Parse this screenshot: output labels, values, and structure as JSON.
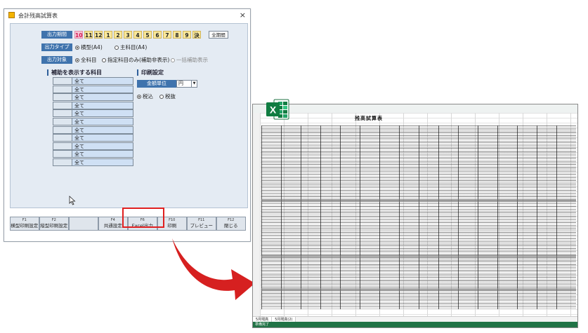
{
  "window": {
    "title": "会計残高試算表",
    "close": "×"
  },
  "output_period": {
    "label": "出力期間",
    "months": [
      "10",
      "11",
      "12",
      "1",
      "2",
      "3",
      "4",
      "5",
      "6",
      "7",
      "8",
      "9",
      "決"
    ],
    "all_button": "全期間"
  },
  "output_type": {
    "label": "出力タイプ",
    "options": [
      {
        "label": "横型(A4)",
        "selected": true
      },
      {
        "label": "主科目(A4)",
        "selected": false
      }
    ]
  },
  "output_target": {
    "label": "出力対象",
    "options": [
      {
        "label": "全科目",
        "selected": true
      },
      {
        "label": "指定科目のみ(補助非表示)",
        "selected": false
      },
      {
        "label": "一括補助表示",
        "selected": false
      }
    ]
  },
  "subaccounts": {
    "heading": "補助を表示する科目",
    "rows": [
      "全て",
      "全て",
      "全て",
      "全て",
      "全て",
      "全て",
      "全て",
      "全て",
      "全て",
      "全て",
      "全て"
    ]
  },
  "print_settings": {
    "heading": "印刷設定",
    "unit_label": "金額単位",
    "unit_value": "円",
    "tax_options": [
      {
        "label": "税込",
        "selected": true
      },
      {
        "label": "税抜",
        "selected": false
      }
    ]
  },
  "function_keys": [
    {
      "key": "F1",
      "label": "横型印刷設定"
    },
    {
      "key": "F2",
      "label": "縦型印刷設定"
    },
    {
      "key": "",
      "label": ""
    },
    {
      "key": "F4",
      "label": "共通設定"
    },
    {
      "key": "F6",
      "label": "Excel出力"
    },
    {
      "key": "F10",
      "label": "印刷"
    },
    {
      "key": "F11",
      "label": "プレビュー"
    },
    {
      "key": "F12",
      "label": "閉じる"
    }
  ],
  "excel_preview": {
    "app_letter": "X",
    "title": "残高試算表",
    "sheet_tabs": [
      "5月残高",
      "5月残高(2)"
    ],
    "status": "準備完了"
  },
  "colors": {
    "accent": "#3f73ad",
    "highlight": "#e02020",
    "excel": "#217346",
    "arrow": "#d62020"
  }
}
